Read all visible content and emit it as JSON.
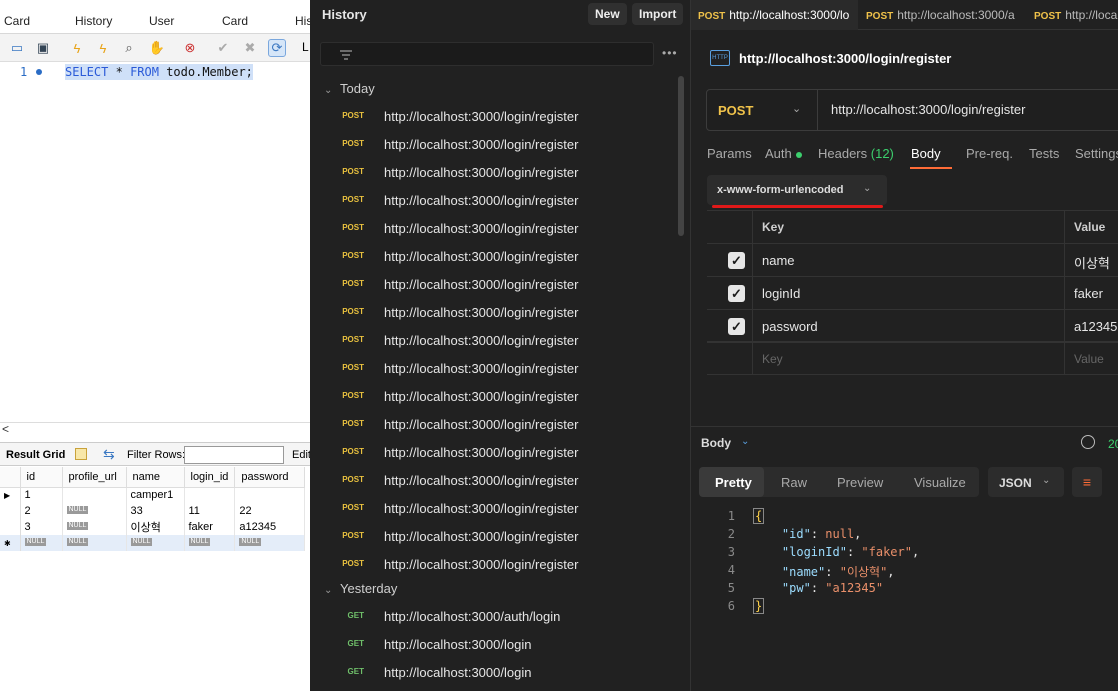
{
  "sql_workbench": {
    "tabs": [
      "Card",
      "History",
      "User",
      "Card",
      "His"
    ],
    "editor": {
      "line_number": "1",
      "query": "SELECT * FROM todo.Member;"
    },
    "scroll_left_arrow": "<",
    "result_grid": {
      "title": "Result Grid",
      "filter_label": "Filter Rows:",
      "edit_label": "Edit",
      "columns": [
        "id",
        "profile_url",
        "name",
        "login_id",
        "password"
      ],
      "null_label": "NULL",
      "rows": [
        [
          "1",
          "",
          "camper1",
          "",
          ""
        ],
        [
          "2",
          "NULL",
          "33",
          "11",
          "22"
        ],
        [
          "3",
          "NULL",
          "이상혁",
          "faker",
          "a12345"
        ],
        [
          "NULL",
          "NULL",
          "NULL",
          "NULL",
          "NULL"
        ]
      ]
    }
  },
  "history": {
    "title": "History",
    "new_label": "New",
    "import_label": "Import",
    "groups": [
      {
        "label": "Today",
        "items": [
          {
            "method": "POST",
            "url": "http://localhost:3000/login/register"
          },
          {
            "method": "POST",
            "url": "http://localhost:3000/login/register"
          },
          {
            "method": "POST",
            "url": "http://localhost:3000/login/register"
          },
          {
            "method": "POST",
            "url": "http://localhost:3000/login/register"
          },
          {
            "method": "POST",
            "url": "http://localhost:3000/login/register"
          },
          {
            "method": "POST",
            "url": "http://localhost:3000/login/register"
          },
          {
            "method": "POST",
            "url": "http://localhost:3000/login/register"
          },
          {
            "method": "POST",
            "url": "http://localhost:3000/login/register"
          },
          {
            "method": "POST",
            "url": "http://localhost:3000/login/register"
          },
          {
            "method": "POST",
            "url": "http://localhost:3000/login/register"
          },
          {
            "method": "POST",
            "url": "http://localhost:3000/login/register"
          },
          {
            "method": "POST",
            "url": "http://localhost:3000/login/register"
          },
          {
            "method": "POST",
            "url": "http://localhost:3000/login/register"
          },
          {
            "method": "POST",
            "url": "http://localhost:3000/login/register"
          },
          {
            "method": "POST",
            "url": "http://localhost:3000/login/register"
          },
          {
            "method": "POST",
            "url": "http://localhost:3000/login/register"
          },
          {
            "method": "POST",
            "url": "http://localhost:3000/login/register"
          }
        ]
      },
      {
        "label": "Yesterday",
        "items": [
          {
            "method": "GET",
            "url": "http://localhost:3000/auth/login"
          },
          {
            "method": "GET",
            "url": "http://localhost:3000/login"
          },
          {
            "method": "GET",
            "url": "http://localhost:3000/login"
          }
        ]
      }
    ]
  },
  "request": {
    "tabs": [
      {
        "method": "POST",
        "url": "http://localhost:3000/lo"
      },
      {
        "method": "POST",
        "url": "http://localhost:3000/a"
      },
      {
        "method": "POST",
        "url": "http://localho"
      }
    ],
    "title": "http://localhost:3000/login/register",
    "http_badge": "HTTP",
    "method": "POST",
    "url": "http://localhost:3000/login/register",
    "subtabs": {
      "params": "Params",
      "auth": "Auth",
      "headers": "Headers",
      "headers_count": "(12)",
      "body": "Body",
      "prereq": "Pre-req.",
      "tests": "Tests",
      "settings": "Settings"
    },
    "body_type": "x-www-form-urlencoded",
    "kv_header": {
      "key": "Key",
      "value": "Value"
    },
    "kv_rows": [
      {
        "key": "name",
        "value": "이상혁"
      },
      {
        "key": "loginId",
        "value": "faker"
      },
      {
        "key": "password",
        "value": "a12345"
      }
    ],
    "kv_placeholder": {
      "key": "Key",
      "value": "Value"
    },
    "response": {
      "label": "Body",
      "status": "20",
      "views": [
        "Pretty",
        "Raw",
        "Preview",
        "Visualize"
      ],
      "format": "JSON",
      "lines": [
        {
          "no": "1"
        },
        {
          "no": "2",
          "key": "\"id\"",
          "value": "null",
          "comma": ","
        },
        {
          "no": "3",
          "key": "\"loginId\"",
          "value": "\"faker\"",
          "comma": ","
        },
        {
          "no": "4",
          "key": "\"name\"",
          "value": "\"이상혁\"",
          "comma": ","
        },
        {
          "no": "5",
          "key": "\"pw\"",
          "value": "\"a12345\"",
          "comma": ""
        },
        {
          "no": "6"
        }
      ],
      "open_brace": "{",
      "close_brace": "}"
    }
  }
}
